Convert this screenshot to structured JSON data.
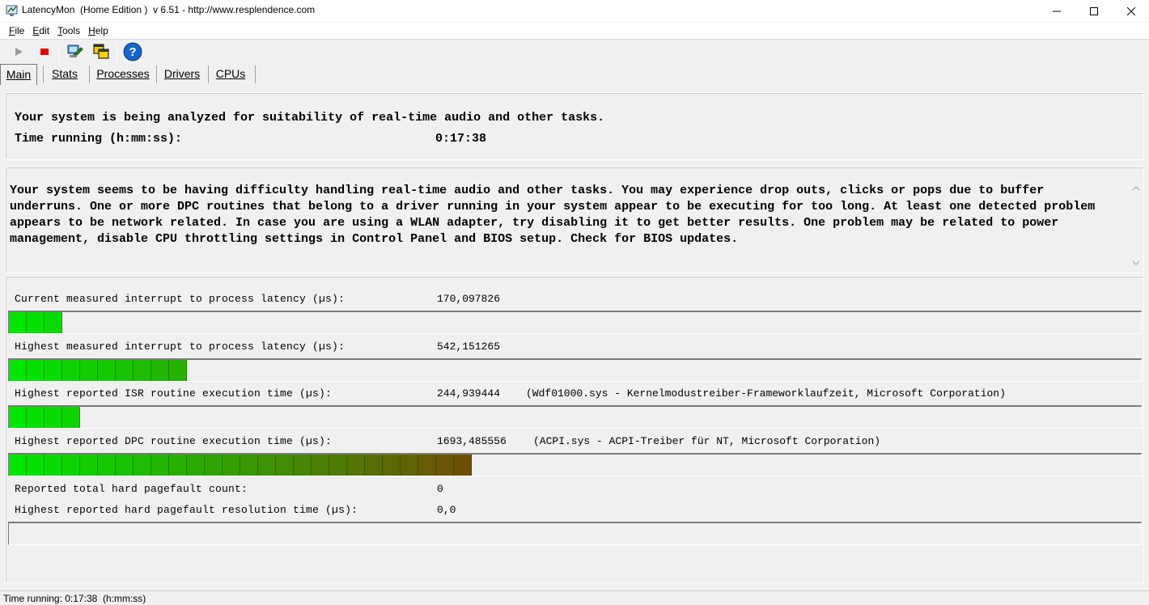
{
  "window": {
    "title": "LatencyMon  (Home Edition )  v 6.51 - http://www.resplendence.com"
  },
  "menu": [
    {
      "label": "File",
      "accel": "F",
      "rest": "ile"
    },
    {
      "label": "Edit",
      "accel": "E",
      "rest": "dit"
    },
    {
      "label": "Tools",
      "accel": "T",
      "rest": "ools"
    },
    {
      "label": "Help",
      "accel": "H",
      "rest": "elp"
    }
  ],
  "toolbar": {
    "icons": [
      "play-icon",
      "stop-icon",
      "analyze-icon",
      "windows-icon",
      "help-icon"
    ],
    "colors": {
      "play": "#9a9a9a",
      "stop": "#e00000",
      "help": "#1a64c8"
    }
  },
  "tabs": [
    {
      "label": "Main",
      "active": true
    },
    {
      "label": "Stats",
      "active": false
    },
    {
      "label": "Processes",
      "active": false
    },
    {
      "label": "Drivers",
      "active": false
    },
    {
      "label": "CPUs",
      "active": false
    }
  ],
  "status_panel": {
    "line1": "Your system is being analyzed for suitability of real-time audio and other tasks.",
    "time_label": "Time running (h:mm:ss):",
    "time_value": "0:17:38"
  },
  "conclusion": {
    "text": "Your system seems to be having difficulty handling real-time audio and other tasks. You may experience drop outs, clicks or pops due to buffer underruns. One or more DPC routines that belong to a driver running in your system appear to be executing for too long. At least one detected problem appears to be network related. In case you are using a WLAN adapter, try disabling it to get better results. One problem may be related to power management, disable CPU throttling settings in Control Panel and BIOS setup. Check for BIOS updates."
  },
  "measurements": {
    "current_latency": {
      "label": "Current measured interrupt to process latency (µs):",
      "value": "170,097826",
      "meter_blocks": 3
    },
    "highest_latency": {
      "label": "Highest measured interrupt to process latency (µs):",
      "value": "542,151265",
      "meter_blocks": 10
    },
    "highest_isr": {
      "label": "Highest reported ISR routine execution time (µs):",
      "value": "244,939444",
      "driver": "(Wdf01000.sys - Kernelmodustreiber-Frameworklaufzeit, Microsoft Corporation)",
      "meter_blocks": 4
    },
    "highest_dpc": {
      "label": "Highest reported DPC routine execution time (µs):",
      "value": "1693,485556",
      "driver": "(ACPI.sys - ACPI-Treiber für NT, Microsoft Corporation)",
      "meter_blocks": 26
    },
    "pagefault_count": {
      "label": "Reported total hard pagefault count:",
      "value": "0"
    },
    "pagefault_time": {
      "label": "Highest reported hard pagefault resolution time (µs):",
      "value": "0,0",
      "meter_blocks": 0
    }
  },
  "statusbar": {
    "text": "Time running: 0:17:38  (h:mm:ss)"
  }
}
